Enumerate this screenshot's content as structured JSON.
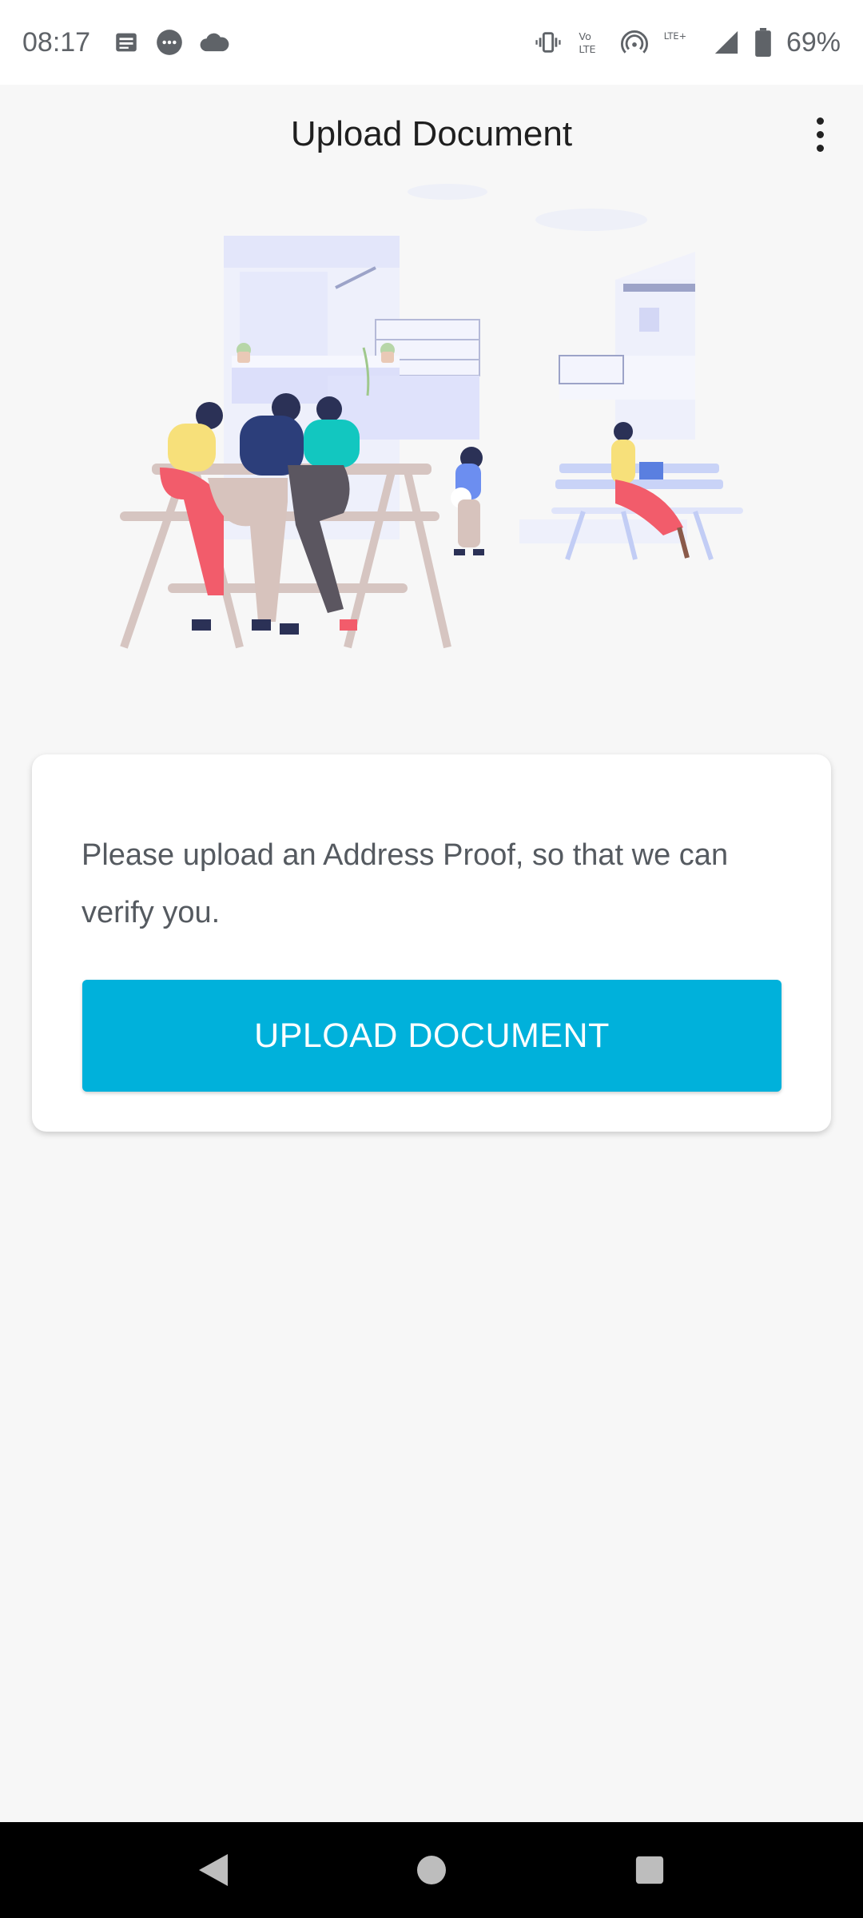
{
  "status_bar": {
    "time": "08:17",
    "battery": "69%",
    "left_icons": [
      "notes-icon",
      "chat-bubble-icon",
      "cloud-icon"
    ],
    "right_icons": [
      "vibrate-icon",
      "volte-icon",
      "hotspot-icon",
      "lte-plus-icon",
      "signal-icon",
      "battery-icon"
    ],
    "volte_label": "Vo LTE",
    "lte_label": "LTE+"
  },
  "app_bar": {
    "title": "Upload Document"
  },
  "card": {
    "message": "Please upload an Address Proof, so that we can verify you.",
    "button_label": "UPLOAD DOCUMENT"
  },
  "colors": {
    "accent": "#00b1db",
    "background": "#f7f7f7",
    "card": "#ffffff"
  },
  "nav_bar": {
    "icons": [
      "back-icon",
      "home-icon",
      "recents-icon"
    ]
  }
}
